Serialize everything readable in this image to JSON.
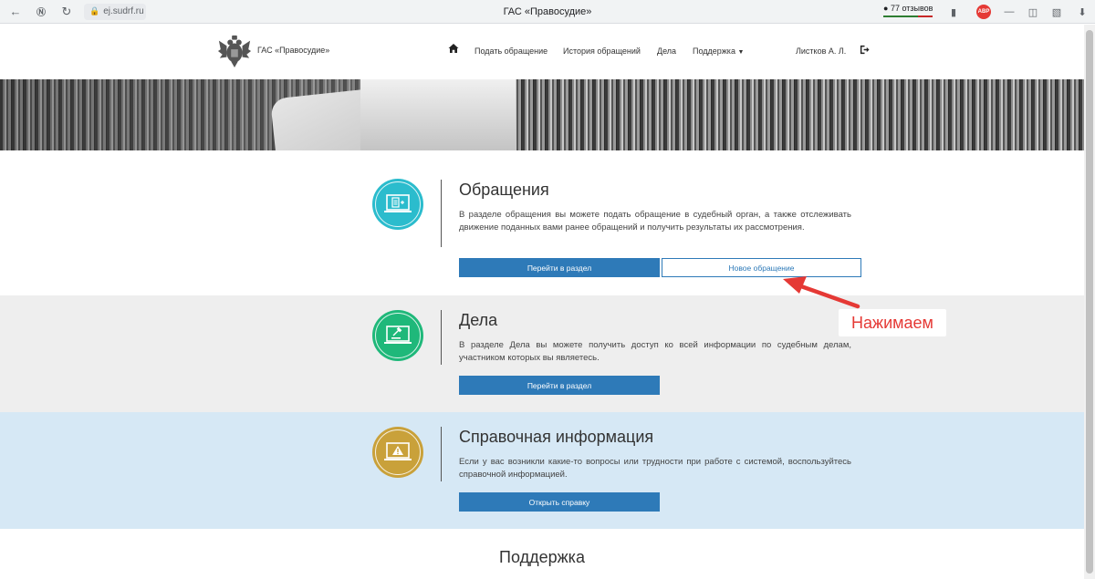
{
  "browser": {
    "url": "ej.sudrf.ru",
    "tab_title": "ГАС «Правосудие»",
    "reviews": "77 отзывов",
    "abp_badge": "ABP"
  },
  "header": {
    "logo_text": "ГАС «Правосудие»",
    "nav": [
      "Подать обращение",
      "История обращений",
      "Дела",
      "Поддержка"
    ],
    "user": "Листков А. Л."
  },
  "sections": {
    "appeals": {
      "title": "Обращения",
      "description": "В разделе обращения вы можете подать обращение в судебный орган, а также отслеживать движение поданных вами ранее обращений и получить результаты их рассмотрения.",
      "primary_button": "Перейти в раздел",
      "secondary_button": "Новое обращение",
      "icon_color": "#2bbccd"
    },
    "cases": {
      "title": "Дела",
      "description": "В разделе Дела вы можете получить доступ ко всей информации по судебным делам, участником которых вы являетесь.",
      "primary_button": "Перейти в раздел",
      "icon_color": "#1fb87a"
    },
    "help": {
      "title": "Справочная информация",
      "description": "Если у вас возникли какие-то вопросы или трудности при работе с системой, воспользуйтесь справочной информацией.",
      "primary_button": "Открыть справку",
      "icon_color": "#c9a13a"
    },
    "support": {
      "title": "Поддержка"
    }
  },
  "annotation": {
    "text": "Нажимаем",
    "color": "#e53935"
  }
}
